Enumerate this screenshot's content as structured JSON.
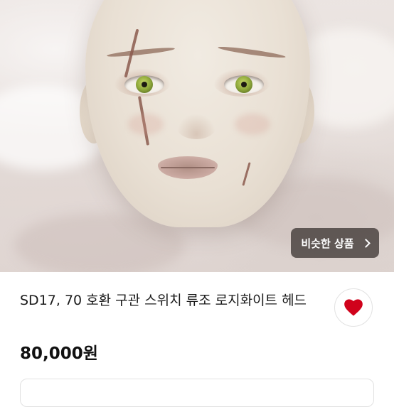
{
  "product": {
    "title": "SD17, 70 호환 구관 스위치 류조 로지화이트 헤드",
    "price": "80,000원"
  },
  "similar_button": {
    "label": "비슷한 상품",
    "icon": "chevron-right-icon"
  },
  "like_button": {
    "icon": "heart-icon",
    "color": "#d0021b"
  },
  "colors": {
    "overlay_button": "#463e3c",
    "text": "#1a1a1a"
  }
}
